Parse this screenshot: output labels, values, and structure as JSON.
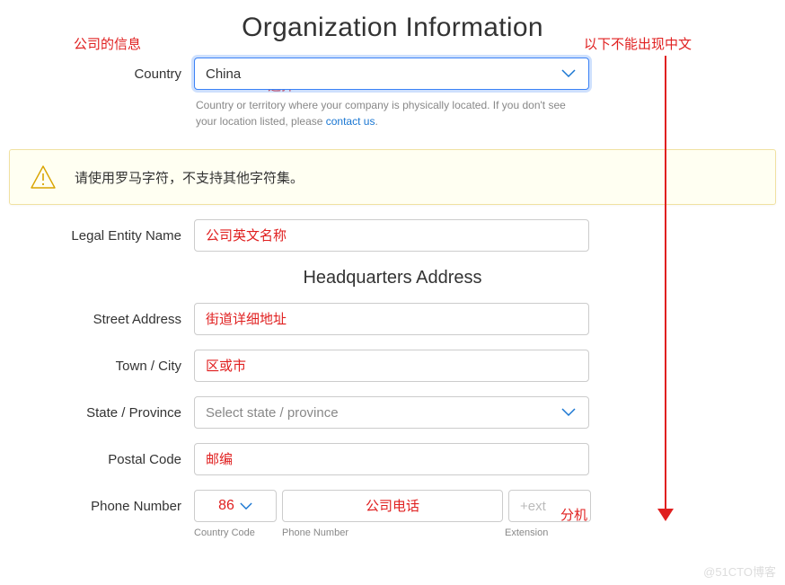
{
  "annotations": {
    "topleft": "公司的信息",
    "topright": "以下不能出现中文",
    "country_select": "选择China",
    "ext_note": "分机"
  },
  "title": "Organization Information",
  "country": {
    "label": "Country",
    "value": "China",
    "help_prefix": "Country or territory where your company is physically located. If you don't see your location listed, please ",
    "help_link": "contact us",
    "help_suffix": "."
  },
  "alert": "请使用罗马字符，不支持其他字符集。",
  "legal_entity": {
    "label": "Legal Entity Name",
    "placeholder": "公司英文名称"
  },
  "hq_heading": "Headquarters Address",
  "street": {
    "label": "Street Address",
    "placeholder": "街道详细地址"
  },
  "city": {
    "label": "Town / City",
    "placeholder": "区或市"
  },
  "state": {
    "label": "State / Province",
    "placeholder": "Select state / province"
  },
  "postal": {
    "label": "Postal Code",
    "placeholder": "邮编"
  },
  "phone": {
    "label": "Phone Number",
    "cc_value": "86",
    "number_placeholder": "公司电话",
    "ext_placeholder": "+ext",
    "sub_cc": "Country Code",
    "sub_number": "Phone Number",
    "sub_ext": "Extension"
  },
  "watermark": "@51CTO博客"
}
